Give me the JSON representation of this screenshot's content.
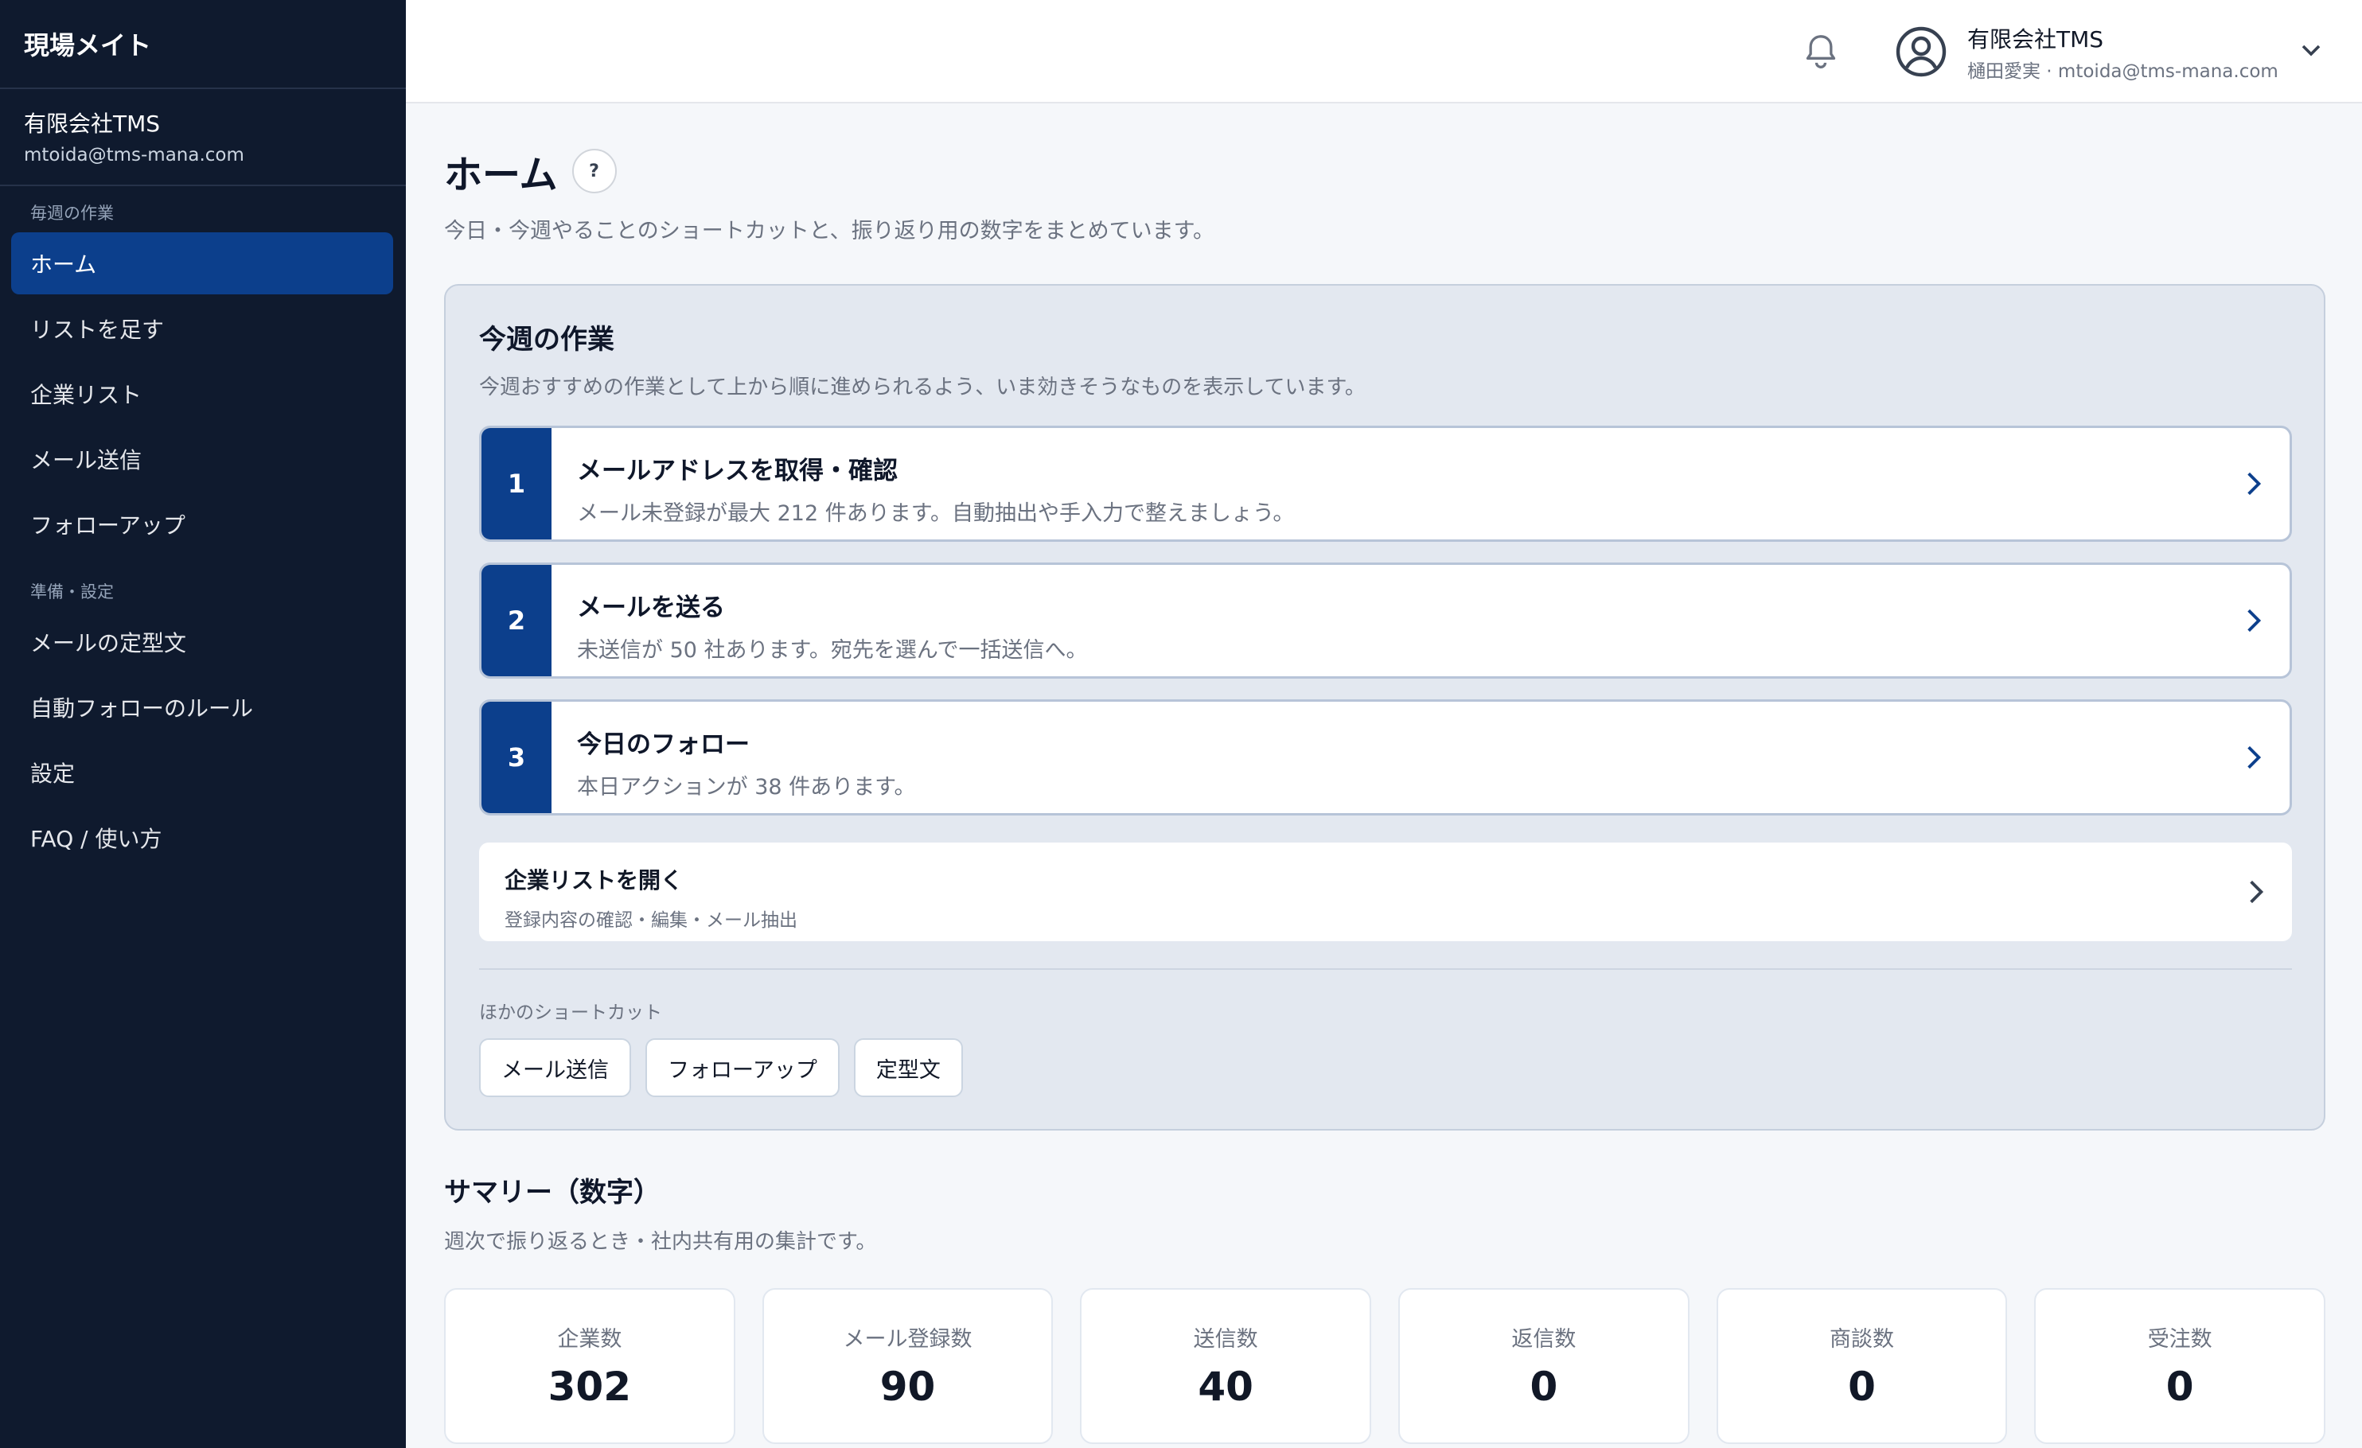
{
  "app": {
    "title": "現場メイト"
  },
  "account": {
    "company": "有限会社TMS",
    "email": "mtoida@tms-mana.com"
  },
  "sidebar": {
    "section_weekly": "毎週の作業",
    "weekly_items": [
      {
        "label": "ホーム",
        "active": true
      },
      {
        "label": "リストを足す"
      },
      {
        "label": "企業リスト"
      },
      {
        "label": "メール送信"
      },
      {
        "label": "フォローアップ"
      }
    ],
    "section_setup": "準備・設定",
    "setup_items": [
      {
        "label": "メールの定型文"
      },
      {
        "label": "自動フォローのルール"
      },
      {
        "label": "設定"
      },
      {
        "label": "FAQ / 使い方"
      }
    ]
  },
  "header": {
    "bell_icon": "bell-icon",
    "user_company": "有限会社TMS",
    "user_detail": "樋田愛実 · mtoida@tms-mana.com"
  },
  "page": {
    "title": "ホーム",
    "help_label": "?",
    "subtitle": "今日・今週やることのショートカットと、振り返り用の数字をまとめています。"
  },
  "week": {
    "title": "今週の作業",
    "subtitle": "今週おすすめの作業として上から順に進められるよう、いま効きそうなものを表示しています。",
    "tasks": [
      {
        "num": "1",
        "title": "メールアドレスを取得・確認",
        "desc": "メール未登録が最大 212 件あります。自動抽出や手入力で整えましょう。"
      },
      {
        "num": "2",
        "title": "メールを送る",
        "desc": "未送信が 50 社あります。宛先を選んで一括送信へ。"
      },
      {
        "num": "3",
        "title": "今日のフォロー",
        "desc": "本日アクションが 38 件あります。"
      }
    ],
    "open_list": {
      "title": "企業リストを開く",
      "desc": "登録内容の確認・編集・メール抽出"
    },
    "other_label": "ほかのショートカット",
    "shortcuts": [
      "メール送信",
      "フォローアップ",
      "定型文"
    ]
  },
  "summary": {
    "title": "サマリー（数字）",
    "subtitle": "週次で振り返るとき・社内共有用の集計です。",
    "stats": [
      {
        "label": "企業数",
        "value": "302"
      },
      {
        "label": "メール登録数",
        "value": "90"
      },
      {
        "label": "送信数",
        "value": "40"
      },
      {
        "label": "返信数",
        "value": "0"
      },
      {
        "label": "商談数",
        "value": "0"
      },
      {
        "label": "受注数",
        "value": "0"
      }
    ]
  },
  "colors": {
    "sidebar_bg": "#0f1a2e",
    "accent": "#0c3f8c",
    "panel_bg": "#e3e8f0"
  }
}
